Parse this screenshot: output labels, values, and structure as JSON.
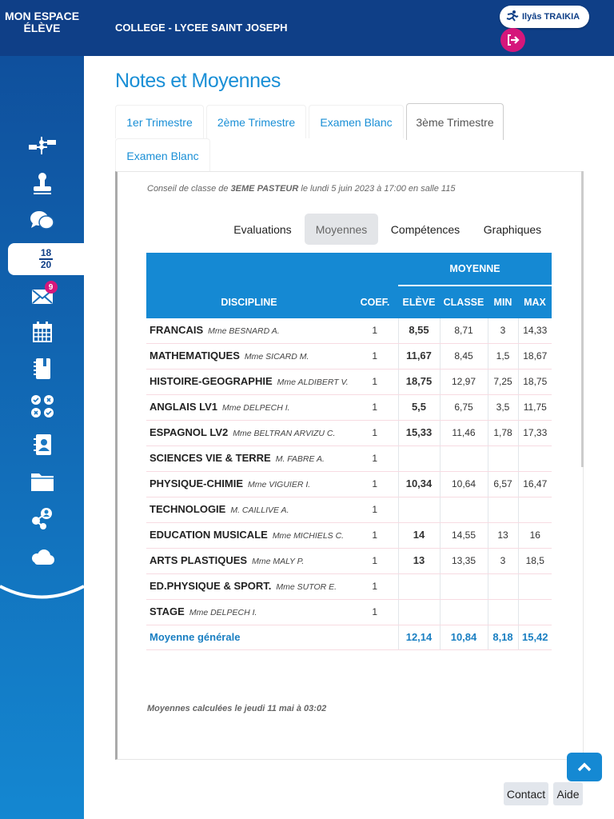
{
  "header": {
    "brand_line1": "MON ESPACE",
    "brand_line2": "ÉLÈVE",
    "school": "COLLEGE - LYCEE SAINT JOSEPH",
    "user": "Ilyâs TRAIKIA"
  },
  "sidebar": {
    "items": [
      {
        "icon": "network-icon"
      },
      {
        "icon": "stamp-icon"
      },
      {
        "icon": "chat-icon"
      },
      {
        "icon": "grades-icon",
        "num": "18",
        "den": "20",
        "active": true
      },
      {
        "icon": "mail-icon",
        "badge": "9"
      },
      {
        "icon": "calendar-icon"
      },
      {
        "icon": "notebook-icon"
      },
      {
        "icon": "quiz-icon"
      },
      {
        "icon": "contacts-icon"
      },
      {
        "icon": "folder-icon"
      },
      {
        "icon": "share-icon"
      },
      {
        "icon": "cloud-icon"
      }
    ]
  },
  "page": {
    "title": "Notes et Moyennes"
  },
  "tabs": [
    "1er Trimestre",
    "2ème Trimestre",
    "Examen Blanc",
    "3ème Trimestre",
    "Examen Blanc"
  ],
  "conseil": {
    "prefix": "Conseil de classe de ",
    "classe": "3EME PASTEUR",
    "suffix": " le lundi 5 juin 2023  à 17:00 en salle 115"
  },
  "subtabs": [
    "Evaluations",
    "Moyennes",
    "Compétences",
    "Graphiques"
  ],
  "table": {
    "headers": {
      "moyenne": "MOYENNE",
      "discipline": "DISCIPLINE",
      "coef": "COEF.",
      "eleve": "ELÈVE",
      "classe": "CLASSE",
      "min": "MIN",
      "max": "MAX"
    },
    "rows": [
      {
        "discipline": "FRANCAIS",
        "prof": "Mme BESNARD A.",
        "coef": "1",
        "eleve": "8,55",
        "classe": "8,71",
        "min": "3",
        "max": "14,33"
      },
      {
        "discipline": "MATHEMATIQUES",
        "prof": "Mme SICARD M.",
        "coef": "1",
        "eleve": "11,67",
        "classe": "8,45",
        "min": "1,5",
        "max": "18,67"
      },
      {
        "discipline": "HISTOIRE-GEOGRAPHIE",
        "prof": "Mme ALDIBERT V.",
        "coef": "1",
        "eleve": "18,75",
        "classe": "12,97",
        "min": "7,25",
        "max": "18,75"
      },
      {
        "discipline": "ANGLAIS LV1",
        "prof": "Mme DELPECH I.",
        "coef": "1",
        "eleve": "5,5",
        "classe": "6,75",
        "min": "3,5",
        "max": "11,75"
      },
      {
        "discipline": "ESPAGNOL LV2",
        "prof": "Mme BELTRAN ARVIZU C.",
        "coef": "1",
        "eleve": "15,33",
        "classe": "11,46",
        "min": "1,78",
        "max": "17,33"
      },
      {
        "discipline": "SCIENCES VIE & TERRE",
        "prof": "M. FABRE A.",
        "coef": "1",
        "eleve": "",
        "classe": "",
        "min": "",
        "max": ""
      },
      {
        "discipline": "PHYSIQUE-CHIMIE",
        "prof": "Mme VIGUIER I.",
        "coef": "1",
        "eleve": "10,34",
        "classe": "10,64",
        "min": "6,57",
        "max": "16,47"
      },
      {
        "discipline": "TECHNOLOGIE",
        "prof": "M. CAILLIVE A.",
        "coef": "1",
        "eleve": "",
        "classe": "",
        "min": "",
        "max": ""
      },
      {
        "discipline": "EDUCATION MUSICALE",
        "prof": "Mme MICHIELS C.",
        "coef": "1",
        "eleve": "14",
        "classe": "14,55",
        "min": "13",
        "max": "16"
      },
      {
        "discipline": "ARTS PLASTIQUES",
        "prof": "Mme MALY P.",
        "coef": "1",
        "eleve": "13",
        "classe": "13,35",
        "min": "3",
        "max": "18,5"
      },
      {
        "discipline": "ED.PHYSIQUE & SPORT.",
        "prof": "Mme SUTOR E.",
        "coef": "1",
        "eleve": "",
        "classe": "",
        "min": "",
        "max": ""
      },
      {
        "discipline": "STAGE",
        "prof": "Mme DELPECH I.",
        "coef": "1",
        "eleve": "",
        "classe": "",
        "min": "",
        "max": ""
      }
    ],
    "total": {
      "label": "Moyenne générale",
      "eleve": "12,14",
      "classe": "10,84",
      "min": "8,18",
      "max": "15,42"
    }
  },
  "calc_note": "Moyennes calculées le jeudi 11 mai à 03:02",
  "footer": {
    "contact": "Contact",
    "aide": "Aide"
  }
}
